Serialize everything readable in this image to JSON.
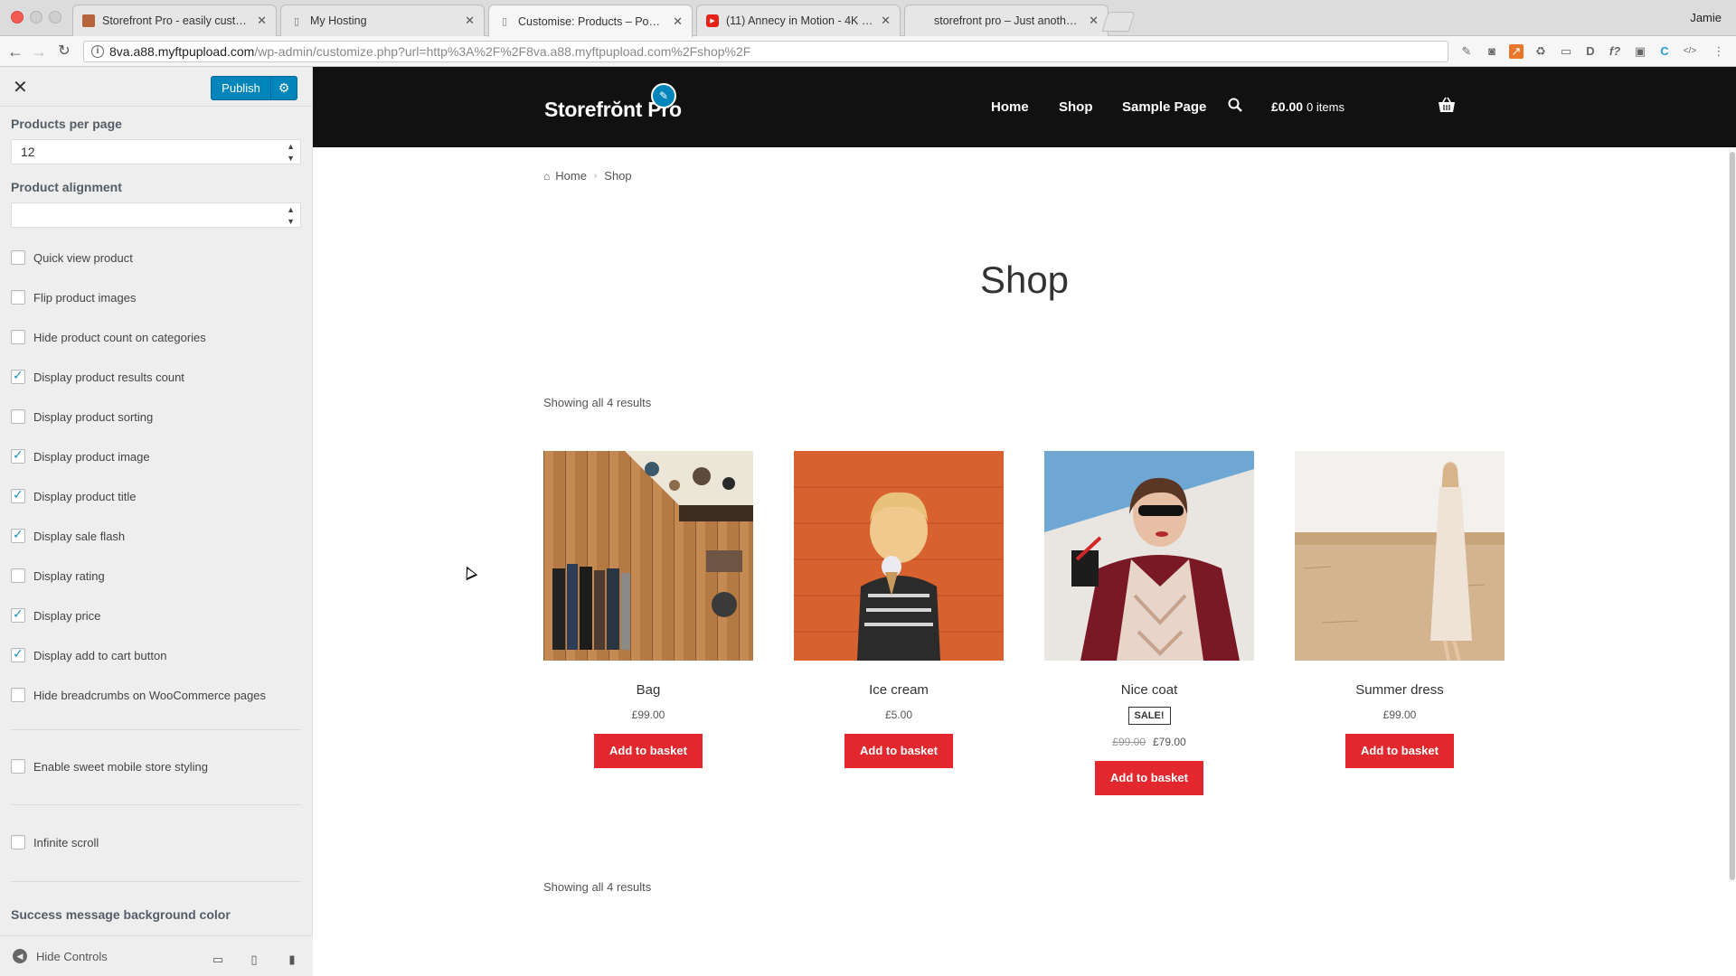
{
  "browser": {
    "tabs": [
      {
        "label": "Storefront Pro - easily custom",
        "active": false
      },
      {
        "label": "My Hosting",
        "active": false
      },
      {
        "label": "Customise: Products – Pootle",
        "active": true
      },
      {
        "label": "(11) Annecy in Motion - 4K - T",
        "active": false
      },
      {
        "label": "storefront pro – Just another V",
        "active": false
      }
    ],
    "profile": "Jamie",
    "url_host": "8va.a88.myftpupload.com",
    "url_path": "/wp-admin/customize.php?url=http%3A%2F%2F8va.a88.myftpupload.com%2Fshop%2F"
  },
  "sidebar": {
    "publish_label": "Publish",
    "products_per_page_label": "Products per page",
    "products_per_page_value": "12",
    "product_alignment_label": "Product alignment",
    "product_alignment_value": "",
    "options": [
      {
        "label": "Quick view product",
        "checked": false
      },
      {
        "label": "Flip product images",
        "checked": false
      },
      {
        "label": "Hide product count on categories",
        "checked": false
      },
      {
        "label": "Display product results count",
        "checked": true
      },
      {
        "label": "Display product sorting",
        "checked": false
      },
      {
        "label": "Display product image",
        "checked": true
      },
      {
        "label": "Display product title",
        "checked": true
      },
      {
        "label": "Display sale flash",
        "checked": true
      },
      {
        "label": "Display rating",
        "checked": false
      },
      {
        "label": "Display price",
        "checked": true
      },
      {
        "label": "Display add to cart button",
        "checked": true
      },
      {
        "label": "Hide breadcrumbs on WooCommerce pages",
        "checked": false
      }
    ],
    "mobile_styling_label": "Enable sweet mobile store styling",
    "infinite_scroll_label": "Infinite scroll",
    "success_color_label": "Success message background color",
    "hide_controls_label": "Hide Controls"
  },
  "site": {
    "logo": "Storefrŏnt Pro",
    "nav": [
      "Home",
      "Shop",
      "Sample Page"
    ],
    "cart_total": "£0.00",
    "cart_count": "0 items",
    "breadcrumb": [
      "Home",
      "Shop"
    ],
    "page_title": "Shop",
    "results_text_top": "Showing all 4 results",
    "results_text_bottom": "Showing all 4 results",
    "products": [
      {
        "name": "Bag",
        "price": "£99.00",
        "old_price": "",
        "sale": "",
        "button": "Add to basket"
      },
      {
        "name": "Ice cream",
        "price": "£5.00",
        "old_price": "",
        "sale": "",
        "button": "Add to basket"
      },
      {
        "name": "Nice coat",
        "price": "£79.00",
        "old_price": "£99.00",
        "sale": "SALE!",
        "button": "Add to basket"
      },
      {
        "name": "Summer dress",
        "price": "£99.00",
        "old_price": "",
        "sale": "",
        "button": "Add to basket"
      }
    ]
  },
  "colors": {
    "publish_blue": "#0085ba",
    "header_black": "#111111",
    "button_red": "#e2282e"
  }
}
